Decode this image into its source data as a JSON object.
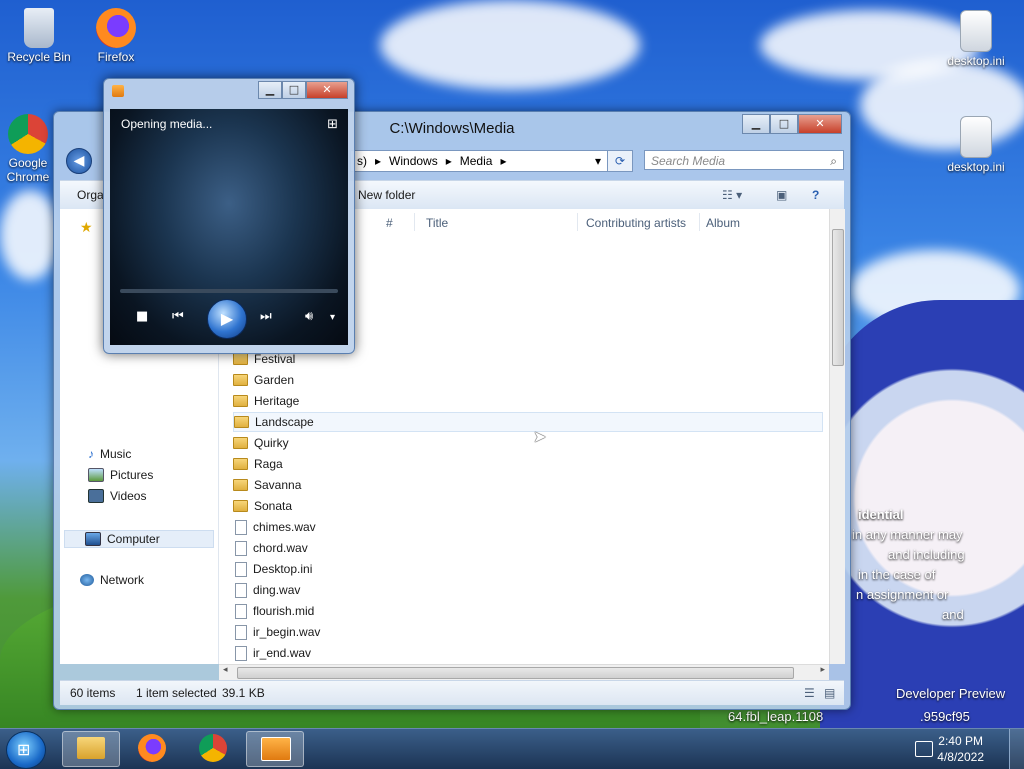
{
  "desktop": {
    "icons": [
      {
        "label": "Recycle Bin"
      },
      {
        "label": "Firefox"
      },
      {
        "label": "Google Chrome"
      },
      {
        "label": "desktop.ini"
      },
      {
        "label": "desktop.ini"
      }
    ],
    "watermark": {
      "line1": "idential",
      "line2": "in any manner may",
      "line3": "and including",
      "line4": "in the case of",
      "line5": "n assignment or",
      "line6": "and",
      "build1": "Developer Preview",
      "build2": "64.fbl_leap.1108",
      "build3": ".959cf95"
    }
  },
  "explorer": {
    "title": "C:\\Windows\\Media",
    "address": {
      "seg1": "Windows",
      "seg2": "Media",
      "lead": "s)"
    },
    "search_placeholder": "Search Media",
    "toolbar": {
      "organize": "Orga",
      "new_folder": "New folder"
    },
    "columns": {
      "num": "#",
      "title": "Title",
      "artists": "Contributing artists",
      "album": "Album"
    },
    "nav": {
      "music": "Music",
      "pictures": "Pictures",
      "videos": "Videos",
      "computer": "Computer",
      "network": "Network"
    },
    "items": [
      {
        "name": "Festival",
        "type": "folder"
      },
      {
        "name": "Garden",
        "type": "folder"
      },
      {
        "name": "Heritage",
        "type": "folder"
      },
      {
        "name": "Landscape",
        "type": "folder"
      },
      {
        "name": "Quirky",
        "type": "folder"
      },
      {
        "name": "Raga",
        "type": "folder"
      },
      {
        "name": "Savanna",
        "type": "folder"
      },
      {
        "name": "Sonata",
        "type": "folder"
      },
      {
        "name": "chimes.wav",
        "type": "file"
      },
      {
        "name": "chord.wav",
        "type": "file"
      },
      {
        "name": "Desktop.ini",
        "type": "file"
      },
      {
        "name": "ding.wav",
        "type": "file"
      },
      {
        "name": "flourish.mid",
        "type": "file"
      },
      {
        "name": "ir_begin.wav",
        "type": "file"
      },
      {
        "name": "ir_end.wav",
        "type": "file"
      }
    ],
    "status": {
      "count": "60 items",
      "selected": "1 item selected",
      "size": "39.1 KB"
    }
  },
  "player": {
    "status": "Opening media..."
  },
  "taskbar": {
    "time": "2:40 PM",
    "date": "4/8/2022"
  }
}
